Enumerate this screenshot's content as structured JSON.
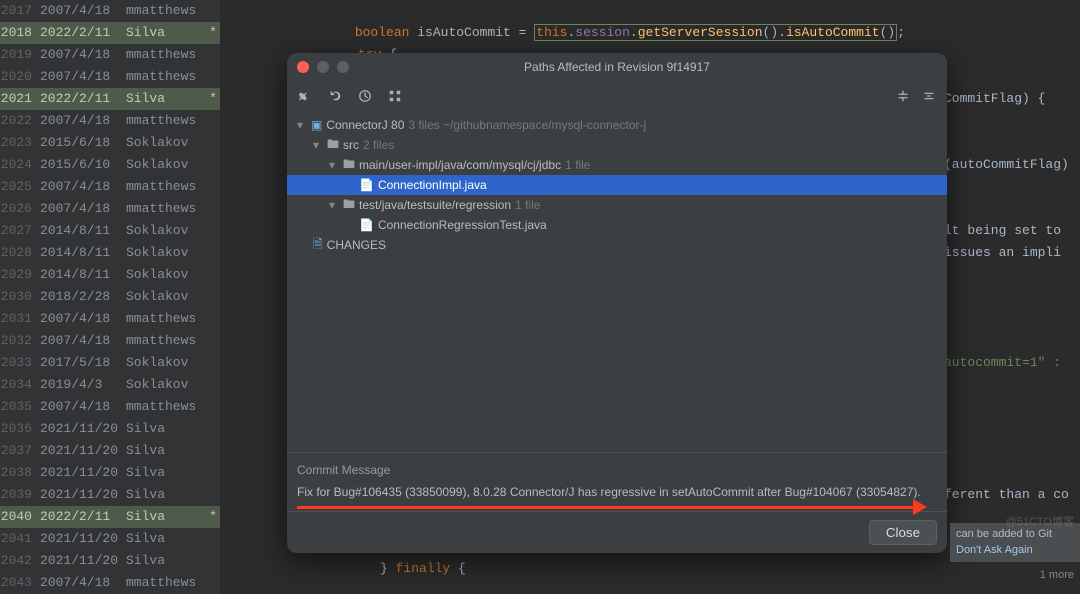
{
  "blame": [
    {
      "ln": "2017",
      "date": "2007/4/18",
      "author": "mmatthews",
      "hl": false,
      "star": ""
    },
    {
      "ln": "2018",
      "date": "2022/2/11",
      "author": "Silva",
      "hl": true,
      "star": "*"
    },
    {
      "ln": "2019",
      "date": "2007/4/18",
      "author": "mmatthews",
      "hl": false,
      "star": ""
    },
    {
      "ln": "2020",
      "date": "2007/4/18",
      "author": "mmatthews",
      "hl": false,
      "star": ""
    },
    {
      "ln": "2021",
      "date": "2022/2/11",
      "author": "Silva",
      "hl": true,
      "star": "*"
    },
    {
      "ln": "2022",
      "date": "2007/4/18",
      "author": "mmatthews",
      "hl": false,
      "star": ""
    },
    {
      "ln": "2023",
      "date": "2015/6/18",
      "author": "Soklakov",
      "hl": false,
      "star": ""
    },
    {
      "ln": "2024",
      "date": "2015/6/10",
      "author": "Soklakov",
      "hl": false,
      "star": ""
    },
    {
      "ln": "2025",
      "date": "2007/4/18",
      "author": "mmatthews",
      "hl": false,
      "star": ""
    },
    {
      "ln": "2026",
      "date": "2007/4/18",
      "author": "mmatthews",
      "hl": false,
      "star": ""
    },
    {
      "ln": "2027",
      "date": "2014/8/11",
      "author": "Soklakov",
      "hl": false,
      "star": ""
    },
    {
      "ln": "2028",
      "date": "2014/8/11",
      "author": "Soklakov",
      "hl": false,
      "star": ""
    },
    {
      "ln": "2029",
      "date": "2014/8/11",
      "author": "Soklakov",
      "hl": false,
      "star": ""
    },
    {
      "ln": "2030",
      "date": "2018/2/28",
      "author": "Soklakov",
      "hl": false,
      "star": ""
    },
    {
      "ln": "2031",
      "date": "2007/4/18",
      "author": "mmatthews",
      "hl": false,
      "star": ""
    },
    {
      "ln": "2032",
      "date": "2007/4/18",
      "author": "mmatthews",
      "hl": false,
      "star": ""
    },
    {
      "ln": "2033",
      "date": "2017/5/18",
      "author": "Soklakov",
      "hl": false,
      "star": ""
    },
    {
      "ln": "2034",
      "date": "2019/4/3",
      "author": "Soklakov",
      "hl": false,
      "star": ""
    },
    {
      "ln": "2035",
      "date": "2007/4/18",
      "author": "mmatthews",
      "hl": false,
      "star": ""
    },
    {
      "ln": "2036",
      "date": "2021/11/20",
      "author": "Silva",
      "hl": false,
      "star": ""
    },
    {
      "ln": "2037",
      "date": "2021/11/20",
      "author": "Silva",
      "hl": false,
      "star": ""
    },
    {
      "ln": "2038",
      "date": "2021/11/20",
      "author": "Silva",
      "hl": false,
      "star": ""
    },
    {
      "ln": "2039",
      "date": "2021/11/20",
      "author": "Silva",
      "hl": false,
      "star": ""
    },
    {
      "ln": "2040",
      "date": "2022/2/11",
      "author": "Silva",
      "hl": true,
      "star": "*"
    },
    {
      "ln": "2041",
      "date": "2021/11/20",
      "author": "Silva",
      "hl": false,
      "star": ""
    },
    {
      "ln": "2042",
      "date": "2021/11/20",
      "author": "Silva",
      "hl": false,
      "star": ""
    },
    {
      "ln": "2043",
      "date": "2007/4/18",
      "author": "mmatthews",
      "hl": false,
      "star": ""
    }
  ],
  "code": {
    "line1_pre": "                ",
    "line1_kw": "boolean",
    "line1_mid": " isAutoCommit = ",
    "line1_boxed": "this.session.getServerSession().isAutoCommit()",
    "line1_end": ";",
    "line2": "                try {",
    "right_frag_1": "CommitFlag) {",
    "right_frag_2": "(autoCommitFlag)",
    "right_frag_3a": "lt being set to",
    "right_frag_3b": "issues an impli",
    "right_frag_4": "autocommit=1\" :",
    "right_frag_5": "ferent than a co",
    "finally": "                } finally {"
  },
  "dialog": {
    "title": "Paths Affected in Revision 9f14917",
    "tree": {
      "root": {
        "name": "ConnectorJ 80",
        "info": "3 files  ~/githubnamespace/mysql-connector-j"
      },
      "src": {
        "name": "src",
        "info": "2 files"
      },
      "main": {
        "name": "main/user-impl/java/com/mysql/cj/jdbc",
        "info": "1 file"
      },
      "file1": "ConnectionImpl.java",
      "test": {
        "name": "test/java/testsuite/regression",
        "info": "1 file"
      },
      "file2": "ConnectionRegressionTest.java",
      "changes": "CHANGES"
    },
    "commit_label": "Commit Message",
    "commit_msg": "Fix for Bug#106435 (33850099), 8.0.28 Connector/J has regressive in setAutoCommit after Bug#104067 (33054827).",
    "close": "Close"
  },
  "notif": {
    "line1": "can be added to Git",
    "line2": "Don't Ask Again"
  },
  "footer": {
    "more": "1 more"
  },
  "watermark": "@51CTO博客"
}
